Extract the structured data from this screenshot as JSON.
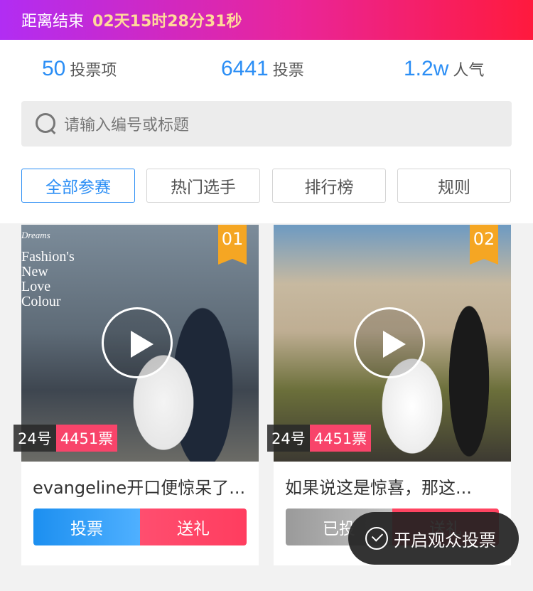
{
  "countdown": {
    "label": "距离结束",
    "time": "02天15时28分31秒"
  },
  "stats": [
    {
      "value": "50",
      "label": "投票项"
    },
    {
      "value": "6441",
      "label": "投票"
    },
    {
      "value": "1.2w",
      "label": "人气"
    }
  ],
  "search": {
    "placeholder": "请输入编号或标题"
  },
  "tabs": [
    "全部参赛",
    "热门选手",
    "排行榜",
    "规则"
  ],
  "cards": [
    {
      "rank": "01",
      "photo_text": {
        "small": "Dreams",
        "lines": [
          "Fashion's",
          "New",
          "Love",
          "Colour"
        ]
      },
      "number": "24号",
      "votes": "4451票",
      "title": "evangeline开口便惊呆了...",
      "vote_label": "投票",
      "gift_label": "送礼"
    },
    {
      "rank": "02",
      "number": "24号",
      "votes": "4451票",
      "title": "如果说这是惊喜，那这...",
      "vote_label": "已投",
      "gift_label": "送礼"
    }
  ],
  "floating": {
    "label": "开启观众投票"
  },
  "colors": {
    "accent": "#2b8ef5",
    "vote_pink": "#f8446a",
    "rank_orange": "#f5a623"
  }
}
